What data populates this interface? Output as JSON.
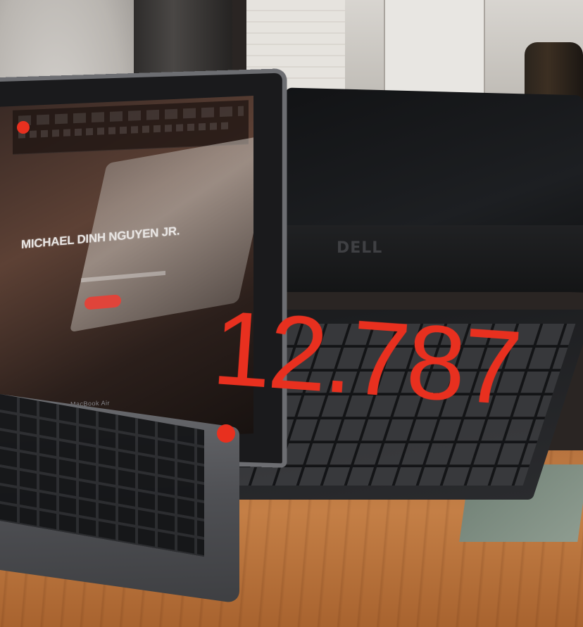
{
  "scene": {
    "laptop_website_title": "MICHAEL DINH NGUYEN JR.",
    "laptop_brand": "MacBook Air",
    "monitor_brand": "DELL"
  },
  "overlay": {
    "measurement": "12.787",
    "marker_color": "#e8301f"
  }
}
